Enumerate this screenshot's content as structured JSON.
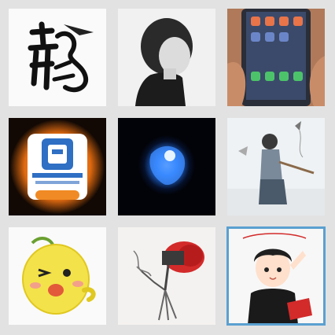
{
  "grid": {
    "tiles": [
      {
        "icon": "calligraphy-dragon-icon"
      },
      {
        "icon": "boy-portrait-icon"
      },
      {
        "icon": "phone-screen-icon"
      },
      {
        "icon": "app-logo-icon",
        "label": "",
        "button": ""
      },
      {
        "icon": "blue-glow-icon"
      },
      {
        "icon": "kite-flyer-icon"
      },
      {
        "icon": "yellow-cartoon-icon"
      },
      {
        "icon": "sketch-fan-icon"
      },
      {
        "icon": "anime-boy-icon",
        "selected": true
      }
    ]
  },
  "colors": {
    "background": "#e2e2e2",
    "selection_border": "#5aa0d0",
    "orange_glow": "#f08a24",
    "blue_glow": "#2a7fff",
    "yellow": "#f4e24a",
    "red": "#d32a2a"
  }
}
